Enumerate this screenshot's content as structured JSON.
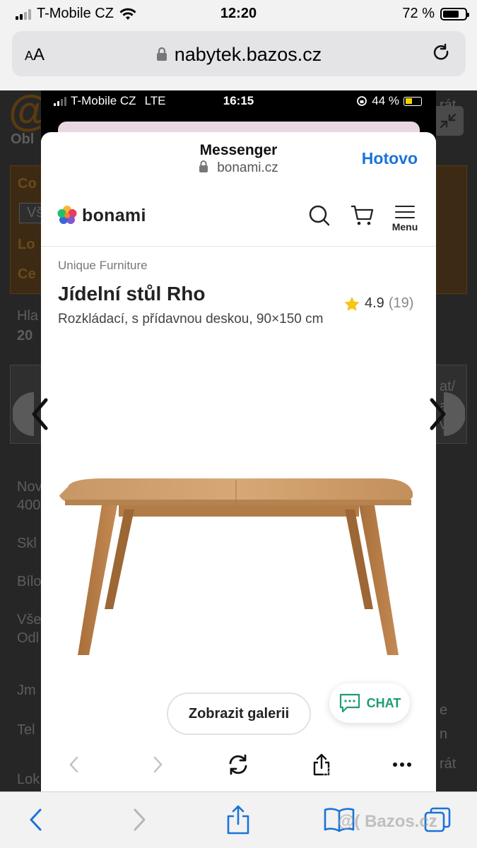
{
  "status": {
    "carrier": "T-Mobile CZ",
    "time": "12:20",
    "battery": "72 %",
    "battery_level": 0.72
  },
  "browser": {
    "text_size": "AA",
    "url": "nabytek.bazos.cz"
  },
  "background_page": {
    "labels": [
      "Obl",
      "Co",
      "Vš",
      "Lo",
      "Ce",
      "Hla",
      "20",
      "Nov",
      "400",
      "Skl",
      "Bílo",
      "Vše",
      "Odl",
      "Jm",
      "Tel",
      "Lok"
    ],
    "right_fragments": [
      "rát",
      "at/",
      "at/",
      "vat",
      "e",
      "n",
      "rát"
    ]
  },
  "inner": {
    "status": {
      "carrier": "T-Mobile CZ",
      "network": "LTE",
      "time": "16:15",
      "battery": "44 %",
      "battery_level": 0.44
    },
    "sheet": {
      "title": "Messenger",
      "domain": "bonami.cz",
      "done": "Hotovo"
    },
    "shop": {
      "logo": "bonami",
      "menu_label": "Menu",
      "brand": "Unique Furniture",
      "product_title": "Jídelní stůl Rho",
      "product_subtitle": "Rozkládací, s přídavnou deskou, 90×150 cm",
      "rating": "4.9",
      "rating_count": "(19)",
      "gallery_button": "Zobrazit galerii",
      "chat_button": "CHAT"
    },
    "toolbar_icons": [
      "back-icon",
      "forward-icon",
      "reload-icon",
      "share-icon",
      "more-icon"
    ]
  },
  "watermark": "@( Bazos.cz",
  "safari_toolbar_icons": [
    "back-icon",
    "forward-icon",
    "share-icon",
    "bookmarks-icon",
    "tabs-icon"
  ]
}
